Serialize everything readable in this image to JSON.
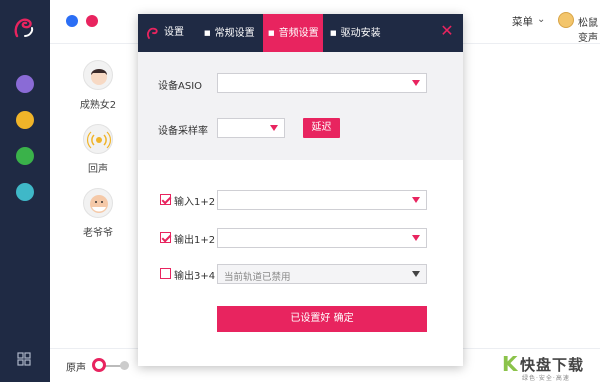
{
  "app": {
    "menu_label": "菜单",
    "user_name": "松鼠变声器",
    "window_dots": [
      "#2b6ef5",
      "#e8245f"
    ],
    "accent_color": "#e8245f",
    "sidebar_color": "#1f2a44"
  },
  "sidebar": {
    "buttons": [
      {
        "icon": "folder-icon",
        "color": "#8a6bd6"
      },
      {
        "icon": "save-icon",
        "color": "#f0b429"
      },
      {
        "icon": "download-icon",
        "color": "#3ab24a"
      },
      {
        "icon": "share-icon",
        "color": "#3fb8c8"
      }
    ],
    "bottom_icon": "grid-icon"
  },
  "voices": [
    {
      "label": "成熟女2",
      "icon": "girl-avatar-icon"
    },
    {
      "label": "回声",
      "icon": "echo-icon"
    },
    {
      "label": "老爷爷",
      "icon": "grandpa-avatar-icon"
    }
  ],
  "bottom": {
    "original_label": "原声"
  },
  "dialog": {
    "tabs": [
      {
        "label": "设置",
        "active": false
      },
      {
        "label": "常规设置",
        "active": false
      },
      {
        "label": "音频设置",
        "active": true
      },
      {
        "label": "驱动安装",
        "active": false
      }
    ],
    "fields": {
      "asio_label": "设备ASIO",
      "asio_value": "",
      "sample_rate_label": "设备采样率",
      "sample_rate_value": "",
      "delay_button": "延迟",
      "input_label": "输入1+2",
      "input_checked": true,
      "input_value": "",
      "output12_label": "输出1+2",
      "output12_checked": true,
      "output12_value": "",
      "output34_label": "输出3+4",
      "output34_checked": false,
      "output34_value": "当前轨道已禁用"
    },
    "confirm_button": "已设置好 确定"
  },
  "watermark": {
    "text": "快盘下载",
    "sub": "绿色·安全·高速"
  }
}
